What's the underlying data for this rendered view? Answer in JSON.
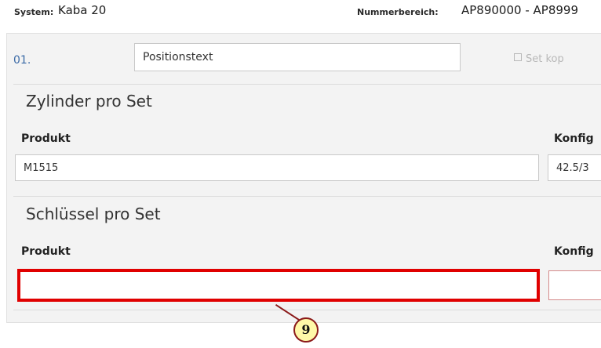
{
  "header": {
    "system_label": "System:",
    "system_value": "Kaba 20",
    "range_label": "Nummerbereich:",
    "range_value": "AP890000 - AP8999"
  },
  "position": {
    "number": "01.",
    "text_value": "Positionstext",
    "set_copy_label": "Set kop"
  },
  "cylinders": {
    "title": "Zylinder pro Set",
    "product_label": "Produkt",
    "product_value": "M1515",
    "config_label": "Konfig",
    "config_value": "42.5/3"
  },
  "keys": {
    "title": "Schlüssel pro Set",
    "product_label": "Produkt",
    "product_value": "",
    "config_label": "Konfig",
    "config_value": ""
  },
  "annotation": {
    "callout_number": "9",
    "highlight_color": "#e00000",
    "badge_color": "#fff8a8"
  }
}
